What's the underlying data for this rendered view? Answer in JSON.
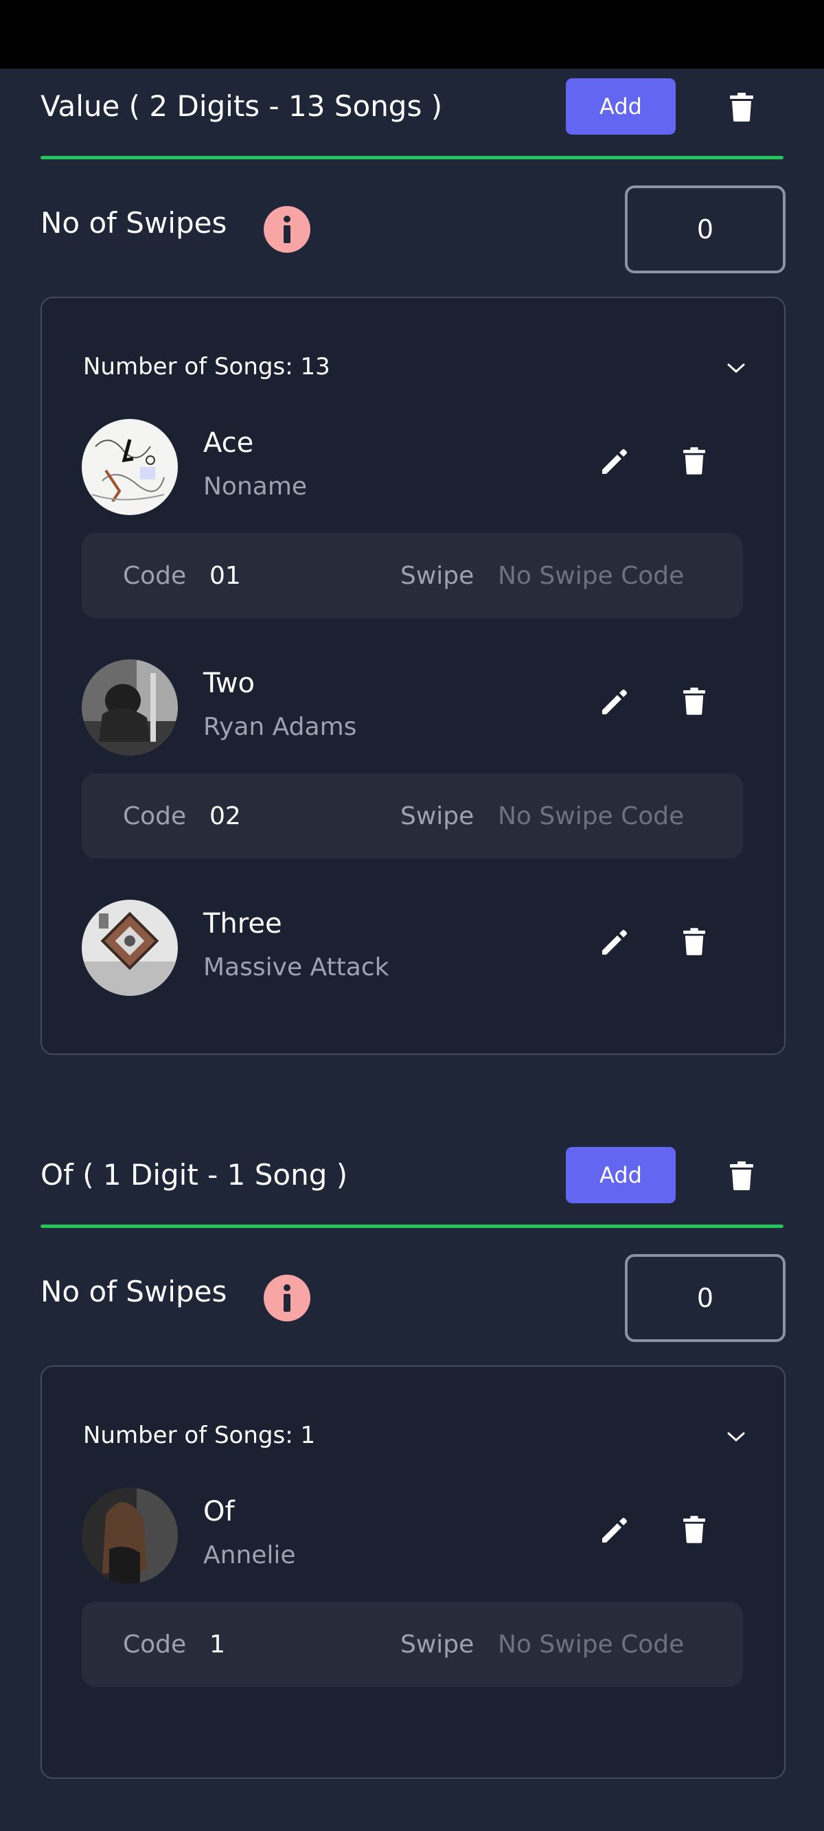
{
  "sections": [
    {
      "title": "Value ( 2 Digits - 13 Songs )",
      "add_label": "Add",
      "swipes_label": "No of Swipes",
      "swipes_value": "0",
      "songs_header": "Number of Songs: 13",
      "songs": [
        {
          "title": "Ace",
          "artist": "Noname",
          "code_label": "Code",
          "code": "01",
          "swipe_label": "Swipe",
          "swipe": "No Swipe Code"
        },
        {
          "title": "Two",
          "artist": "Ryan Adams",
          "code_label": "Code",
          "code": "02",
          "swipe_label": "Swipe",
          "swipe": "No Swipe Code"
        },
        {
          "title": "Three",
          "artist": "Massive Attack"
        }
      ]
    },
    {
      "title": "Of ( 1 Digit - 1 Song )",
      "add_label": "Add",
      "swipes_label": "No of Swipes",
      "swipes_value": "0",
      "songs_header": "Number of Songs: 1",
      "songs": [
        {
          "title": "Of",
          "artist": "Annelie",
          "code_label": "Code",
          "code": "1",
          "swipe_label": "Swipe",
          "swipe": "No Swipe Code"
        }
      ]
    }
  ],
  "icons": {
    "trash": "trash-icon",
    "edit": "pencil-icon",
    "info": "info-icon",
    "chevron": "chevron-down-icon"
  },
  "colors": {
    "background": "#1e2637",
    "accent": "#6366f1",
    "divider": "#22c55e",
    "info_bg": "#f8a5a5"
  }
}
